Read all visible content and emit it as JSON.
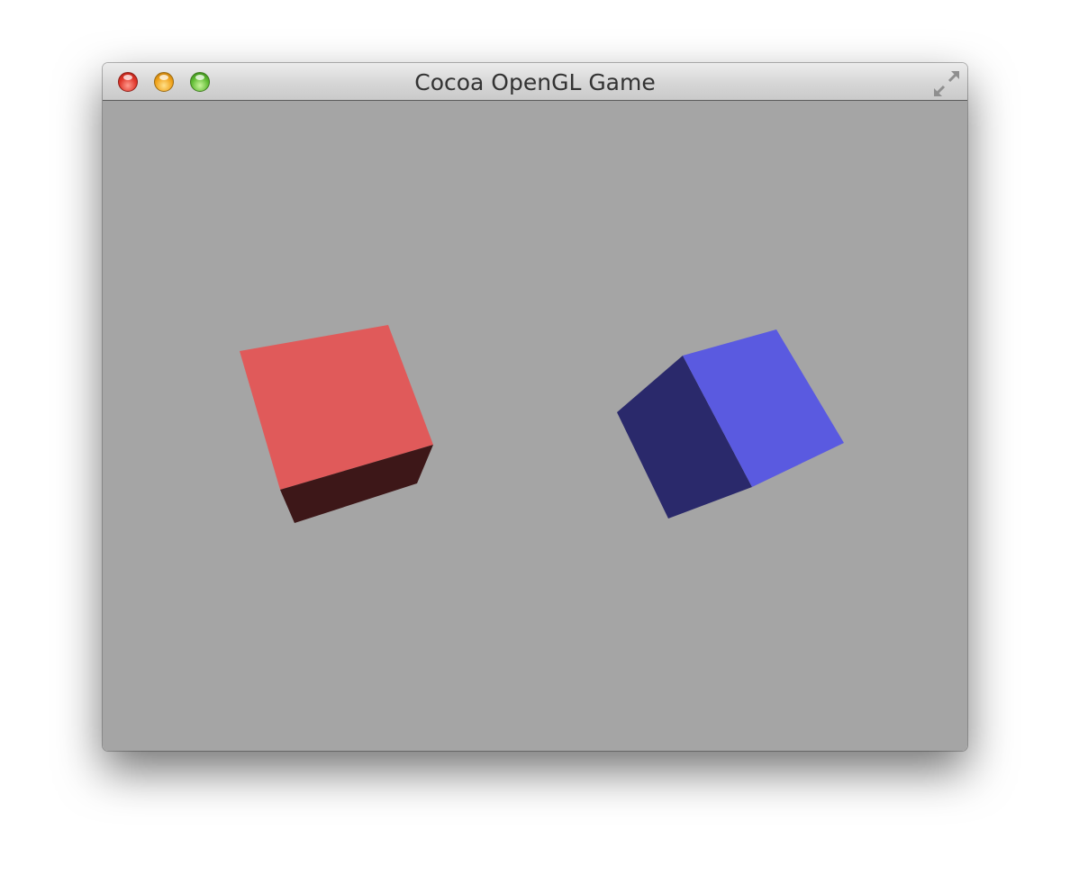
{
  "window": {
    "title": "Cocoa OpenGL Game"
  },
  "icons": {
    "close": "close-icon",
    "minimize": "minimize-icon",
    "zoom": "zoom-icon",
    "fullscreen": "fullscreen-arrows-icon"
  },
  "colors": {
    "background": "#a5a5a5",
    "red_cube_front": "#e05a5a",
    "red_cube_bottom": "#3d1718",
    "blue_cube_front": "#5a5ae0",
    "blue_cube_side": "#2a296b"
  },
  "scene": {
    "objects": [
      {
        "name": "red-cube",
        "color": "red"
      },
      {
        "name": "blue-cube",
        "color": "blue"
      }
    ]
  }
}
